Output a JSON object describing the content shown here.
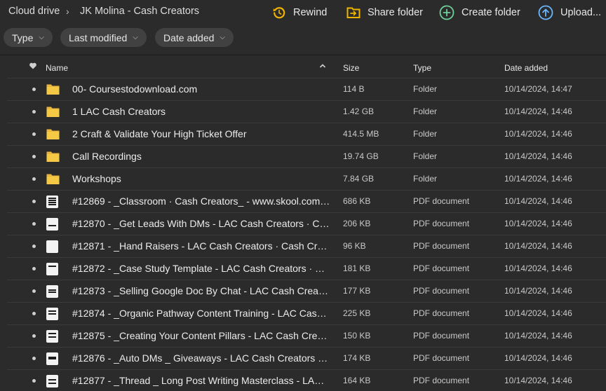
{
  "breadcrumb": {
    "root": "Cloud drive",
    "current": "JK Molina - Cash Creators"
  },
  "actions": {
    "rewind": "Rewind",
    "share": "Share folder",
    "create": "Create folder",
    "upload": "Upload..."
  },
  "filters": [
    "Type",
    "Last modified",
    "Date added"
  ],
  "columns": {
    "name": "Name",
    "size": "Size",
    "type": "Type",
    "date": "Date added"
  },
  "colors": {
    "background": "#2b2b2b",
    "folder": "#f6c945",
    "rewind": "#f0b400",
    "share": "#f0b400",
    "create": "#6fcf97",
    "upload": "#69b7ff"
  },
  "rows": [
    {
      "name": "00- Coursestodownload.com",
      "size": "114 B",
      "type": "Folder",
      "date": "10/14/2024, 14:47",
      "icon": "folder-icon"
    },
    {
      "name": "1 LAC Cash Creators",
      "size": "1.42 GB",
      "type": "Folder",
      "date": "10/14/2024, 14:46",
      "icon": "folder-icon"
    },
    {
      "name": "2 Craft & Validate Your High Ticket Offer",
      "size": "414.5 MB",
      "type": "Folder",
      "date": "10/14/2024, 14:46",
      "icon": "folder-icon"
    },
    {
      "name": "Call Recordings",
      "size": "19.74 GB",
      "type": "Folder",
      "date": "10/14/2024, 14:46",
      "icon": "folder-icon"
    },
    {
      "name": "Workshops",
      "size": "7.84 GB",
      "type": "Folder",
      "date": "10/14/2024, 14:46",
      "icon": "folder-icon"
    },
    {
      "name": "#12869 - _Classroom · Cash Creators_ - www.skool.com.p...",
      "size": "686 KB",
      "type": "PDF document",
      "date": "10/14/2024, 14:46",
      "icon": "pdf-thumbnail-icon"
    },
    {
      "name": "#12870 - _Get Leads With DMs - LAC Cash Creators · Cas...",
      "size": "206 KB",
      "type": "PDF document",
      "date": "10/14/2024, 14:46",
      "icon": "pdf-thumbnail-icon"
    },
    {
      "name": "#12871 - _Hand Raisers - LAC Cash Creators · Cash Creat...",
      "size": "96 KB",
      "type": "PDF document",
      "date": "10/14/2024, 14:46",
      "icon": "pdf-thumbnail-icon"
    },
    {
      "name": "#12872 - _Case Study Template - LAC Cash Creators · Cas...",
      "size": "181 KB",
      "type": "PDF document",
      "date": "10/14/2024, 14:46",
      "icon": "pdf-thumbnail-icon"
    },
    {
      "name": "#12873 - _Selling Google Doc By Chat - LAC Cash Creato...",
      "size": "177 KB",
      "type": "PDF document",
      "date": "10/14/2024, 14:46",
      "icon": "pdf-thumbnail-icon"
    },
    {
      "name": "#12874 - _Organic Pathway Content Training - LAC Cash ...",
      "size": "225 KB",
      "type": "PDF document",
      "date": "10/14/2024, 14:46",
      "icon": "pdf-thumbnail-icon"
    },
    {
      "name": "#12875 - _Creating Your Content Pillars - LAC Cash Creat...",
      "size": "150 KB",
      "type": "PDF document",
      "date": "10/14/2024, 14:46",
      "icon": "pdf-thumbnail-icon"
    },
    {
      "name": "#12876 - _Auto DMs _ Giveaways - LAC Cash Creators · ...",
      "size": "174 KB",
      "type": "PDF document",
      "date": "10/14/2024, 14:46",
      "icon": "pdf-thumbnail-icon"
    },
    {
      "name": "#12877 - _Thread _ Long Post Writing Masterclass - LAC ...",
      "size": "164 KB",
      "type": "PDF document",
      "date": "10/14/2024, 14:46",
      "icon": "pdf-thumbnail-icon"
    }
  ]
}
